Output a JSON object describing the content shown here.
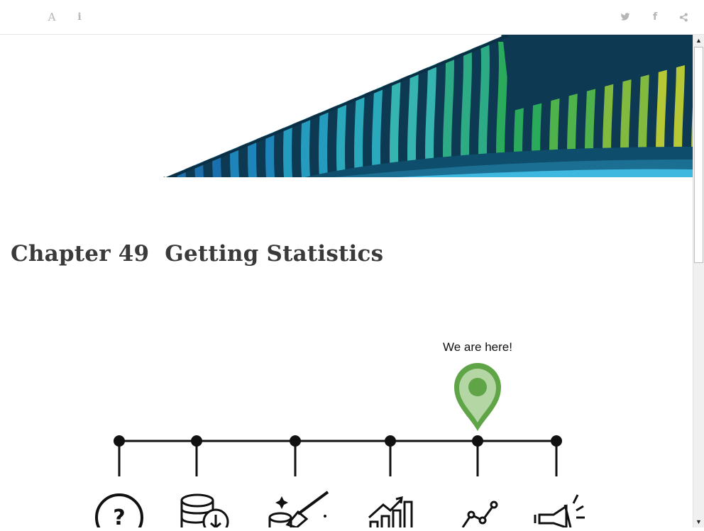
{
  "toolbar": {
    "font_button": "A",
    "info_button": "i",
    "facebook_glyph": "f",
    "icons": [
      "font-settings-icon",
      "info-icon",
      "twitter-icon",
      "facebook-icon",
      "share-icon"
    ]
  },
  "chapter": {
    "number": "Chapter 49",
    "title": "Getting Statistics"
  },
  "diagram": {
    "marker_label": "We are here!",
    "marker_color": "#5fa447",
    "steps": [
      "question-icon",
      "database-download-icon",
      "data-cleaning-icon",
      "bar-chart-icon",
      "line-chart-icon",
      "megaphone-icon"
    ],
    "current_step": 5
  },
  "colors": {
    "banner_dark": "#0d3a52",
    "banner_teal": "#2bb3c4",
    "banner_green": "#2db55d",
    "banner_lime": "#c6d534"
  }
}
